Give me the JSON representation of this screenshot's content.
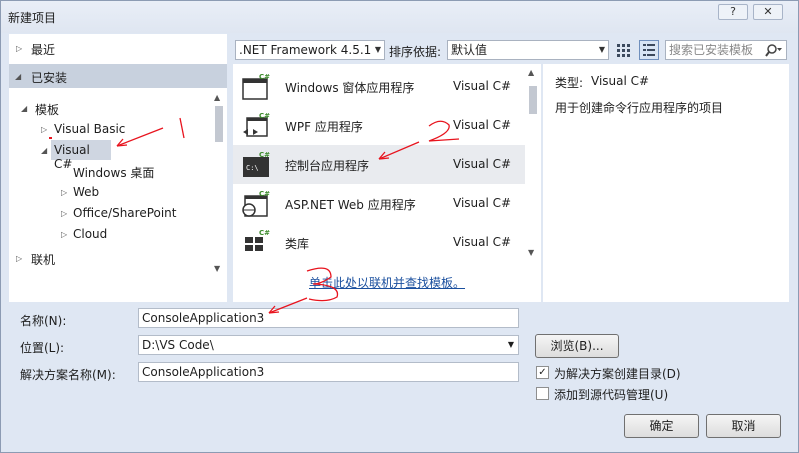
{
  "window": {
    "title": "新建项目",
    "help_label": "?",
    "close_label": "✕"
  },
  "nav": {
    "recent": "最近",
    "installed": "已安装",
    "templates": "模板",
    "tree": [
      "Visual Basic",
      "Visual C#",
      "Windows 桌面",
      "Web",
      "Office/SharePoint",
      "Cloud"
    ],
    "online": "联机"
  },
  "toolbar": {
    "framework": ".NET Framework 4.5.1",
    "sort_label": "排序依据:",
    "sort_value": "默认值",
    "search_placeholder": "搜索已安装模板"
  },
  "templates": [
    {
      "name": "Windows 窗体应用程序",
      "lang": "Visual C#",
      "icon": "windows-forms-icon"
    },
    {
      "name": "WPF 应用程序",
      "lang": "Visual C#",
      "icon": "wpf-icon"
    },
    {
      "name": "控制台应用程序",
      "lang": "Visual C#",
      "icon": "console-icon"
    },
    {
      "name": "ASP.NET Web 应用程序",
      "lang": "Visual C#",
      "icon": "web-app-icon"
    },
    {
      "name": "类库",
      "lang": "Visual C#",
      "icon": "class-library-icon"
    }
  ],
  "online_link": "单击此处以联机并查找模板。",
  "description": {
    "type_label": "类型:",
    "type_value": "Visual C#",
    "text": "用于创建命令行应用程序的项目"
  },
  "form": {
    "name_label": "名称(N):",
    "name_value": "ConsoleApplication3",
    "location_label": "位置(L):",
    "location_value": "D:\\VS Code\\",
    "solution_label": "解决方案名称(M):",
    "solution_value": "ConsoleApplication3",
    "browse": "浏览(B)...",
    "create_dir": "为解决方案创建目录(D)",
    "create_dir_checked": true,
    "add_source_control": "添加到源代码管理(U)",
    "add_source_control_checked": false,
    "ok": "确定",
    "cancel": "取消"
  },
  "annotations": [
    "1",
    "2",
    "3"
  ],
  "colors": {
    "annotation": "#e8141e",
    "selected_nav": "#c8d1de",
    "link": "#1a4f9e"
  }
}
